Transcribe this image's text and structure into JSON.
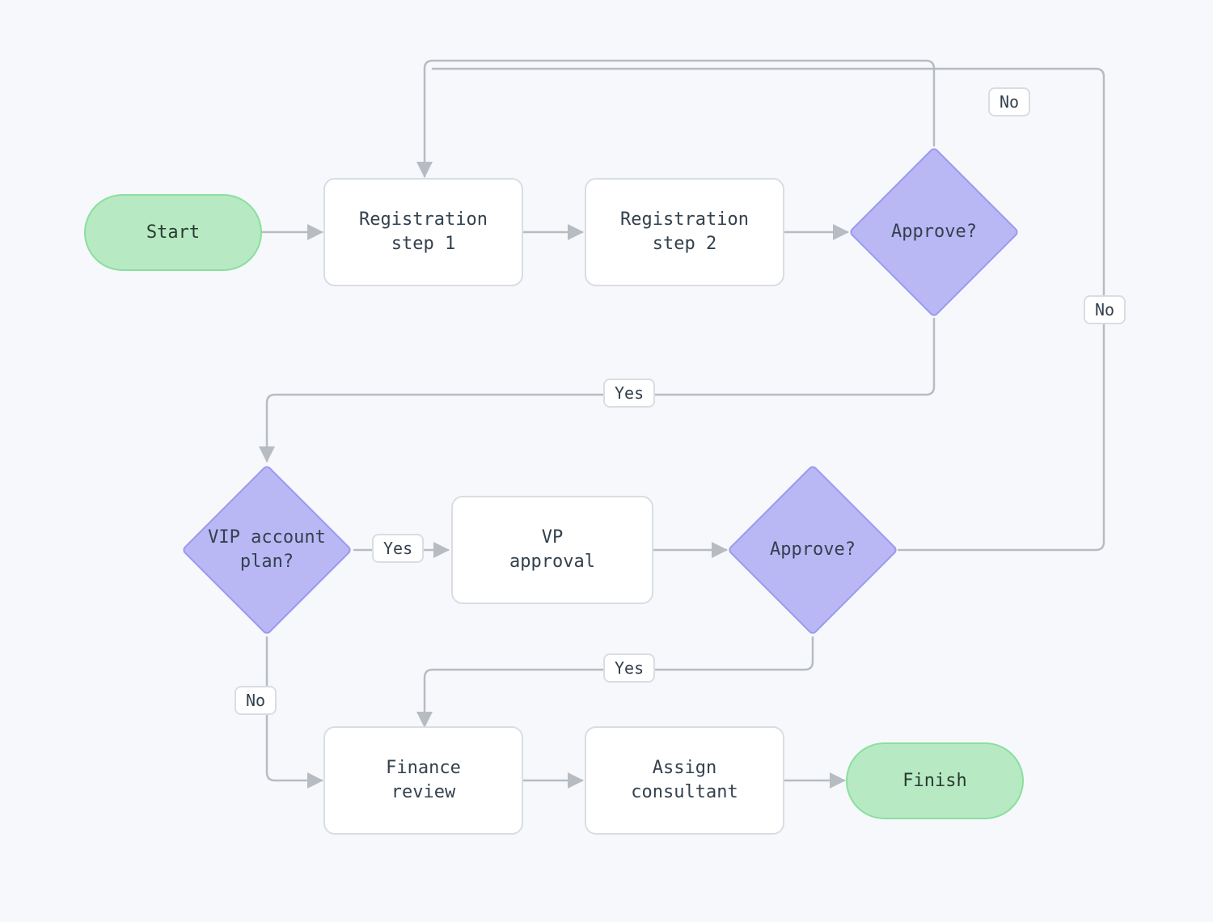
{
  "diagram": {
    "type": "flowchart",
    "nodes": {
      "start": {
        "kind": "terminator",
        "label": "Start"
      },
      "reg1": {
        "kind": "process",
        "label": "Registration\nstep 1"
      },
      "reg2": {
        "kind": "process",
        "label": "Registration\nstep 2"
      },
      "approve1": {
        "kind": "decision",
        "label": "Approve?"
      },
      "vip": {
        "kind": "decision",
        "label": "VIP account\nplan?"
      },
      "vpApproval": {
        "kind": "process",
        "label": "VP\napproval"
      },
      "approve2": {
        "kind": "decision",
        "label": "Approve?"
      },
      "finance": {
        "kind": "process",
        "label": "Finance\nreview"
      },
      "assign": {
        "kind": "process",
        "label": "Assign\nconsultant"
      },
      "finish": {
        "kind": "terminator",
        "label": "Finish"
      }
    },
    "edges": [
      {
        "from": "start",
        "to": "reg1"
      },
      {
        "from": "reg1",
        "to": "reg2"
      },
      {
        "from": "reg2",
        "to": "approve1"
      },
      {
        "from": "approve1",
        "to": "reg1",
        "label": "No"
      },
      {
        "from": "approve1",
        "to": "vip",
        "label": "Yes"
      },
      {
        "from": "vip",
        "to": "vpApproval",
        "label": "Yes"
      },
      {
        "from": "vip",
        "to": "finance",
        "label": "No"
      },
      {
        "from": "vpApproval",
        "to": "approve2"
      },
      {
        "from": "approve2",
        "to": "finance",
        "label": "Yes"
      },
      {
        "from": "approve2",
        "to": "reg1",
        "label": "No"
      },
      {
        "from": "finance",
        "to": "assign"
      },
      {
        "from": "assign",
        "to": "finish"
      }
    ],
    "edgeLabels": {
      "no1": "No",
      "yes1": "Yes",
      "vipYes": "Yes",
      "vipNo": "No",
      "yes2": "Yes",
      "no2": "No"
    }
  }
}
